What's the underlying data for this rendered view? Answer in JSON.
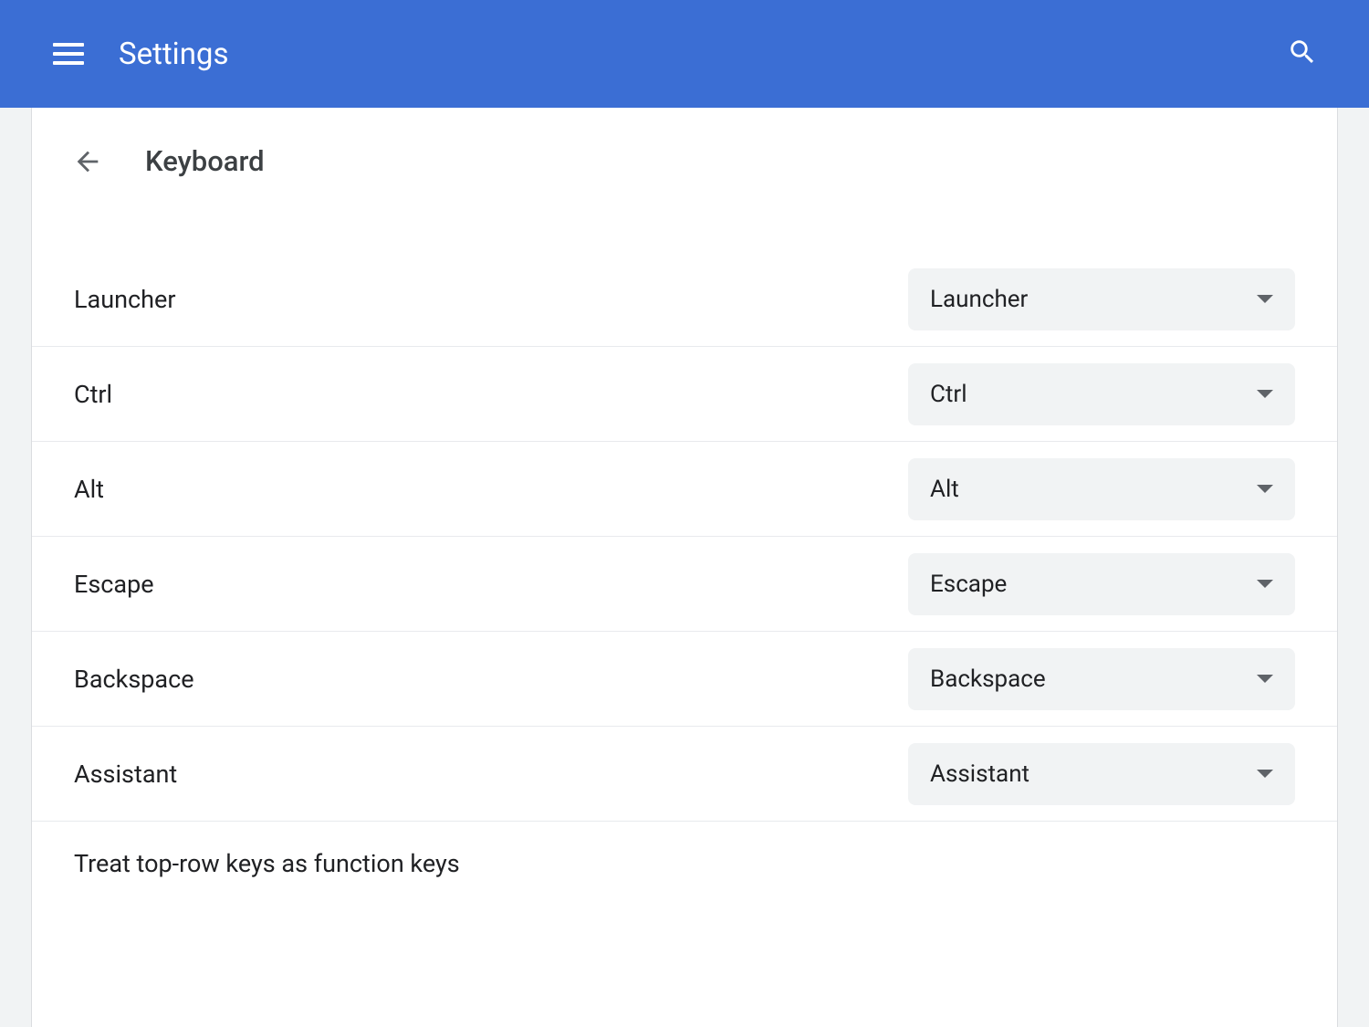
{
  "header": {
    "title": "Settings"
  },
  "subheader": {
    "title": "Keyboard"
  },
  "keys": [
    {
      "label": "Launcher",
      "value": "Launcher"
    },
    {
      "label": "Ctrl",
      "value": "Ctrl"
    },
    {
      "label": "Alt",
      "value": "Alt"
    },
    {
      "label": "Escape",
      "value": "Escape"
    },
    {
      "label": "Backspace",
      "value": "Backspace"
    },
    {
      "label": "Assistant",
      "value": "Assistant"
    }
  ],
  "toggle": {
    "label": "Treat top-row keys as function keys"
  }
}
